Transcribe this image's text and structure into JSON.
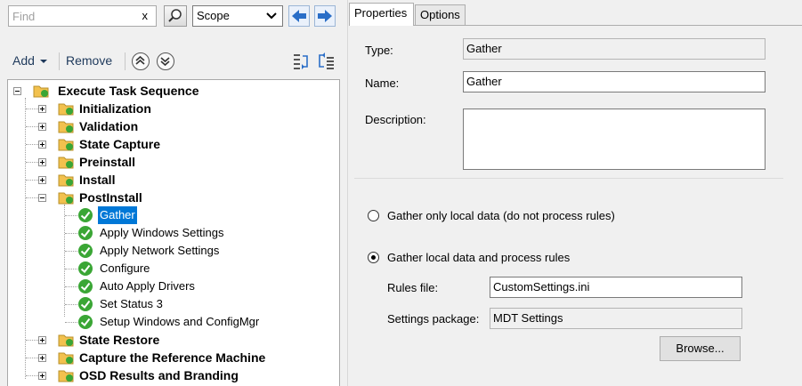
{
  "search": {
    "placeholder": "Find",
    "value": "",
    "clear_label": "x",
    "scope_value": "Scope"
  },
  "toolbar": {
    "add_label": "Add",
    "remove_label": "Remove"
  },
  "tree": {
    "root": "Execute Task Sequence",
    "groups": [
      {
        "label": "Initialization",
        "expanded": false
      },
      {
        "label": "Validation",
        "expanded": false
      },
      {
        "label": "State Capture",
        "expanded": false
      },
      {
        "label": "Preinstall",
        "expanded": false
      },
      {
        "label": "Install",
        "expanded": false
      },
      {
        "label": "PostInstall",
        "expanded": true
      },
      {
        "label": "State Restore",
        "expanded": false
      },
      {
        "label": "Capture the Reference Machine",
        "expanded": false
      },
      {
        "label": "OSD Results and Branding",
        "expanded": false
      }
    ],
    "postinstall_steps": [
      {
        "label": "Gather",
        "selected": true
      },
      {
        "label": "Apply Windows Settings",
        "selected": false
      },
      {
        "label": "Apply Network Settings",
        "selected": false
      },
      {
        "label": "Configure",
        "selected": false
      },
      {
        "label": "Auto Apply Drivers",
        "selected": false
      },
      {
        "label": "Set Status 3",
        "selected": false
      },
      {
        "label": "Setup Windows and ConfigMgr",
        "selected": false
      }
    ]
  },
  "tabs": {
    "properties": "Properties",
    "options": "Options",
    "active": "Properties"
  },
  "properties": {
    "type_label": "Type:",
    "type_value": "Gather",
    "name_label": "Name:",
    "name_value": "Gather",
    "description_label": "Description:",
    "description_value": "",
    "radio_local_only": "Gather only local data (do not process rules)",
    "radio_process_rules": "Gather local data and process rules",
    "selected_radio": "process_rules",
    "rules_file_label": "Rules file:",
    "rules_file_value": "CustomSettings.ini",
    "settings_package_label": "Settings package:",
    "settings_package_value": "MDT Settings",
    "browse_label": "Browse..."
  },
  "colors": {
    "selection": "#0078d7",
    "check_green": "#3aa635",
    "folder_yellow": "#f2c14e",
    "toolbar_text": "#1e395b"
  }
}
